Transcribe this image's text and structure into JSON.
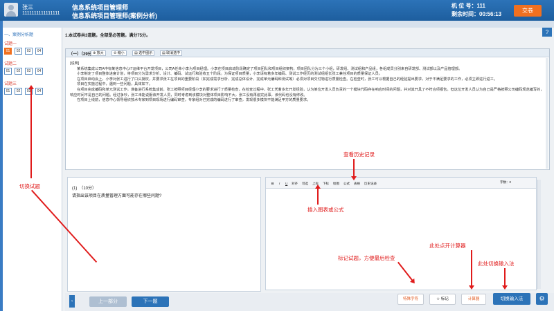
{
  "header": {
    "user_name": "张三",
    "user_id": "1111111111111111",
    "exam_title_1": "信息系统项目管理师",
    "exam_title_2": "信息系统项目管理师(案例分析)",
    "seat": "机 位 号：111",
    "remaining_time": "剩余时间：00:56:13",
    "submit_label": "交卷",
    "help_label": "?"
  },
  "sidebar": {
    "heading": "一、案例分析题",
    "groups": [
      {
        "label": "试题一",
        "items": [
          "01",
          "02",
          "03",
          "04"
        ],
        "active": 0
      },
      {
        "label": "试题二",
        "items": [
          "01",
          "02",
          "03",
          "04"
        ],
        "active": -1
      },
      {
        "label": "试题三",
        "items": [
          "01",
          "02",
          "03",
          "04"
        ],
        "active": -1
      }
    ]
  },
  "instructions": "1.本试卷共3道题，全部是必答题，满分75分。",
  "case": {
    "title": "（一）（29分）",
    "toolbar": [
      "⊕ 放大",
      "⊖ 缩小",
      "▤ 选中图示",
      "▤ 取消选中"
    ],
    "heading": "[说明]",
    "paragraphs": [
      "某系统集成公司A中标某信息中心IT运维平台开发项目，公司A任命小李为项目经理。小李在项目启动阶段确定了项目团队和项目组织架构，项目团队分为三个小组，研发组、测试组和产品组，各组成员分别来自研发部、测试部以及产品管理部。",
      "小李制定了项目整体进度计划，将项目分为需求分析、设计、编码、试运行和验收五个阶段。为保证项目质量，小李请有着多年编码、测试工作经历的测试组组长张工兼任项目的质量保证人员。",
      "在项目启动会上，小李对张工进行了口头授权，并要求张工在项目的重要阶段（如完成需求分析、完成总体设计、完成单元编码和测试等）必须对项目交付物进行质量检查。在检查时，张工可以根据自己的经验提出要求，对于不满足要求的工作，必须立即进行返工。",
      "项目在实施过程中，遇到一些问题，具体如下。",
      "在项目完成编码和单元测试工作，准备进行系统集成前，张工按照项目经理小李的要求进行了质量检查，在检查过程中，张工凭着多年开发经验，认为某位开发人员负责的一个模块代码存在响应时间的问题，并对其开具了不符合项报告。但这位开发人员认为自己是严格按照公司编码规范编写的，响应时间不是自己的问题。经过争吵，张工未能说服该开发人员，同时考虑到该模块对整体项目影响不大，张工没有再追究此事，该代码也没有修改。",
      "在项目上线前，信息中心领导组织技术专家到项目现场进行编码审查，专家组对已完成的编码进行了审查，发现很多模块不能满足甲方的质量要求。"
    ]
  },
  "question": {
    "number": "(1)　（10分）",
    "text": "请指出该项目在质量管理方面可能存在哪些问题?"
  },
  "answer_toolbar": {
    "tools": [
      "B",
      "I",
      "U",
      "对齐",
      "可选",
      "上标",
      "下标",
      "绘图",
      "公式",
      "表格",
      "历史记录"
    ],
    "word_count": "字数：0"
  },
  "annotations": {
    "switch_question": "切换试题",
    "view_history": "查看历史记录",
    "insert_chart": "插入图表或公式",
    "mark_question": "标记试题，方便最后检查",
    "calculator": "此处点开计算器",
    "switch_ime": "此处切换输入法"
  },
  "footer": {
    "prev_label": "上一部分",
    "next_label": "下一题",
    "special_chars_label": "特殊字符",
    "mark_label": "☆ 标记",
    "calculator_label": "计算器",
    "ime_label": "切换输入法",
    "collapse_label": "‹",
    "gear_label": "⚙"
  }
}
